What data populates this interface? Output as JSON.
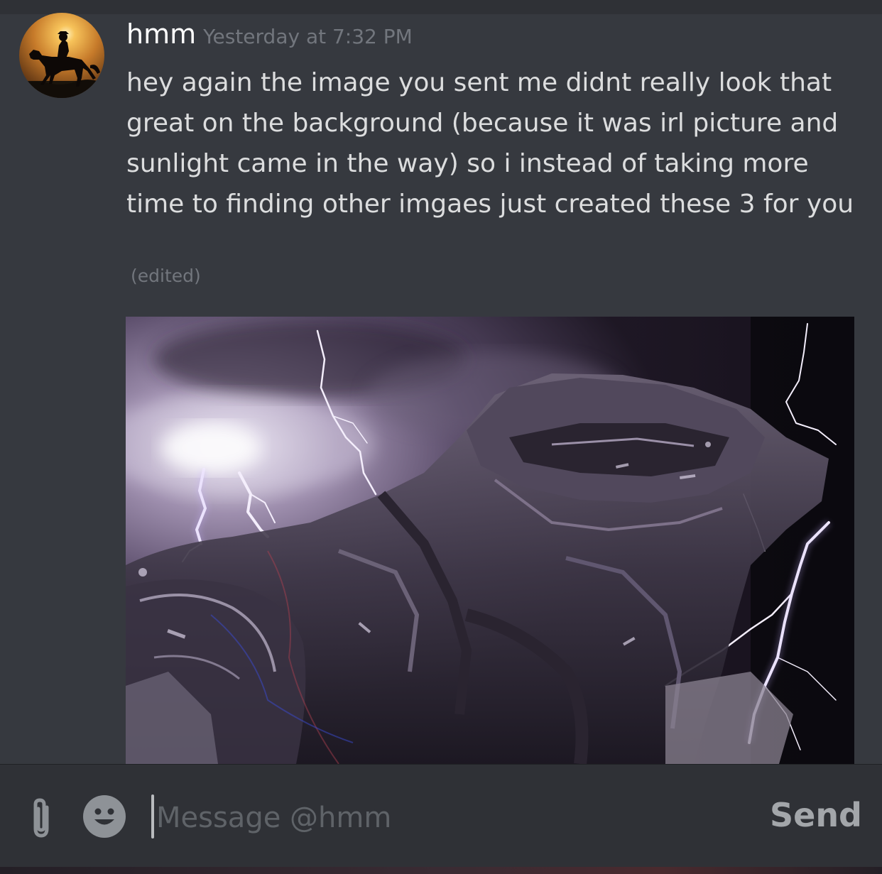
{
  "message": {
    "username": "hmm",
    "timestamp": "Yesterday at 7:32 PM",
    "content": "hey again the image you sent me didnt really look that great on the background (because it was irl picture and sunlight came in the way) so i instead of taking more time to finding other imgaes just created these 3 for you",
    "edited_label": "(edited)",
    "avatar_icon": "horse-rider-avatar-icon",
    "attachment_icon": "lightning-armor-image"
  },
  "composer": {
    "placeholder": "Message @hmm",
    "value": "",
    "send_label": "Send",
    "attach_icon": "paperclip-icon",
    "emoji_icon": "emoji-smiley-icon"
  },
  "colors": {
    "background": "#36393f",
    "composer_background": "#2f3136",
    "username": "#ffffff",
    "text": "#dcddde",
    "muted": "#72767d"
  }
}
